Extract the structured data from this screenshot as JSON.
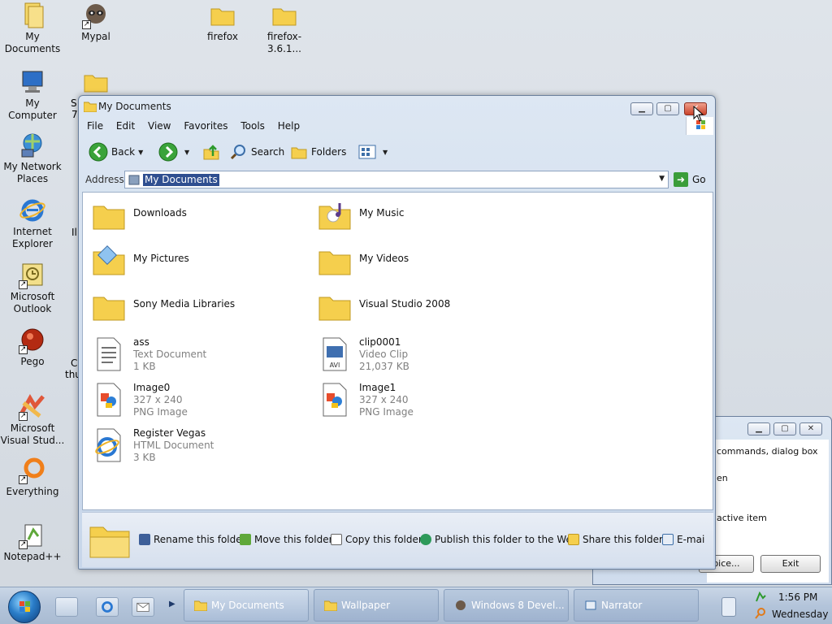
{
  "desktop": {
    "icons": [
      {
        "label": "My Documents",
        "icon": "folder-documents-icon",
        "shortcut": false
      },
      {
        "label": "Mypal",
        "icon": "raccoon-icon",
        "shortcut": true
      },
      {
        "label": "firefox",
        "icon": "folder-icon",
        "shortcut": false
      },
      {
        "label": "firefox-3.6.1...",
        "icon": "folder-icon",
        "shortcut": false
      },
      {
        "label": "My Computer",
        "icon": "computer-icon",
        "shortcut": false
      },
      {
        "label": "My Network Places",
        "icon": "network-icon",
        "shortcut": false
      },
      {
        "label": "Internet Explorer",
        "icon": "ie-icon",
        "shortcut": false
      },
      {
        "label": "Microsoft Outlook",
        "icon": "outlook-icon",
        "shortcut": true
      },
      {
        "label": "Pego",
        "icon": "pego-icon",
        "shortcut": true
      },
      {
        "label": "Microsoft Visual Stud...",
        "icon": "visual-studio-icon",
        "shortcut": true
      },
      {
        "label": "Everything",
        "icon": "everything-icon",
        "shortcut": true
      },
      {
        "label": "Notepad++",
        "icon": "notepadpp-icon",
        "shortcut": true
      }
    ],
    "partial_labels": {
      "s": "S",
      "seven": "7",
      "il": "Il",
      "c": "C",
      "thu": "thu"
    }
  },
  "explorer": {
    "title": "My Documents",
    "menu": [
      "File",
      "Edit",
      "View",
      "Favorites",
      "Tools",
      "Help"
    ],
    "toolbar": {
      "back": "Back",
      "search": "Search",
      "folders": "Folders"
    },
    "address": {
      "label": "Address",
      "value": "My Documents",
      "go": "Go"
    },
    "items": [
      {
        "name": "Downloads",
        "type": "folder"
      },
      {
        "name": "My Music",
        "type": "music-folder"
      },
      {
        "name": "My Pictures",
        "type": "pictures-folder"
      },
      {
        "name": "My Videos",
        "type": "folder"
      },
      {
        "name": "Sony Media Libraries",
        "type": "folder"
      },
      {
        "name": "Visual Studio 2008",
        "type": "folder"
      },
      {
        "name": "ass",
        "type": "text",
        "line1": "Text Document",
        "line2": "1 KB"
      },
      {
        "name": "clip0001",
        "type": "avi",
        "line1": "Video Clip",
        "line2": "21,037 KB"
      },
      {
        "name": "Image0",
        "type": "png",
        "line1": "327 x 240",
        "line2": "PNG Image"
      },
      {
        "name": "Image1",
        "type": "png",
        "line1": "327 x 240",
        "line2": "PNG Image"
      },
      {
        "name": "Register Vegas",
        "type": "html",
        "line1": "HTML Document",
        "line2": "3 KB"
      }
    ],
    "tasks": [
      "Rename this folder",
      "Move this folder",
      "Copy this folder",
      "Publish this folder to the Web",
      "Share this folder",
      "E-mai"
    ]
  },
  "narrator": {
    "lines": [
      "commands, dialog box",
      "en",
      "active item"
    ],
    "buttons": [
      "oice...",
      "Exit"
    ]
  },
  "taskbar": {
    "tasks": [
      "My Documents",
      "Wallpaper",
      "Windows 8 Devel...",
      "Narrator"
    ],
    "time": "1:56 PM",
    "day": "Wednesday"
  },
  "colors": {
    "selection": "#2f4f90",
    "folder": "#f5cf4d",
    "taskbar": "#b3c4da"
  }
}
